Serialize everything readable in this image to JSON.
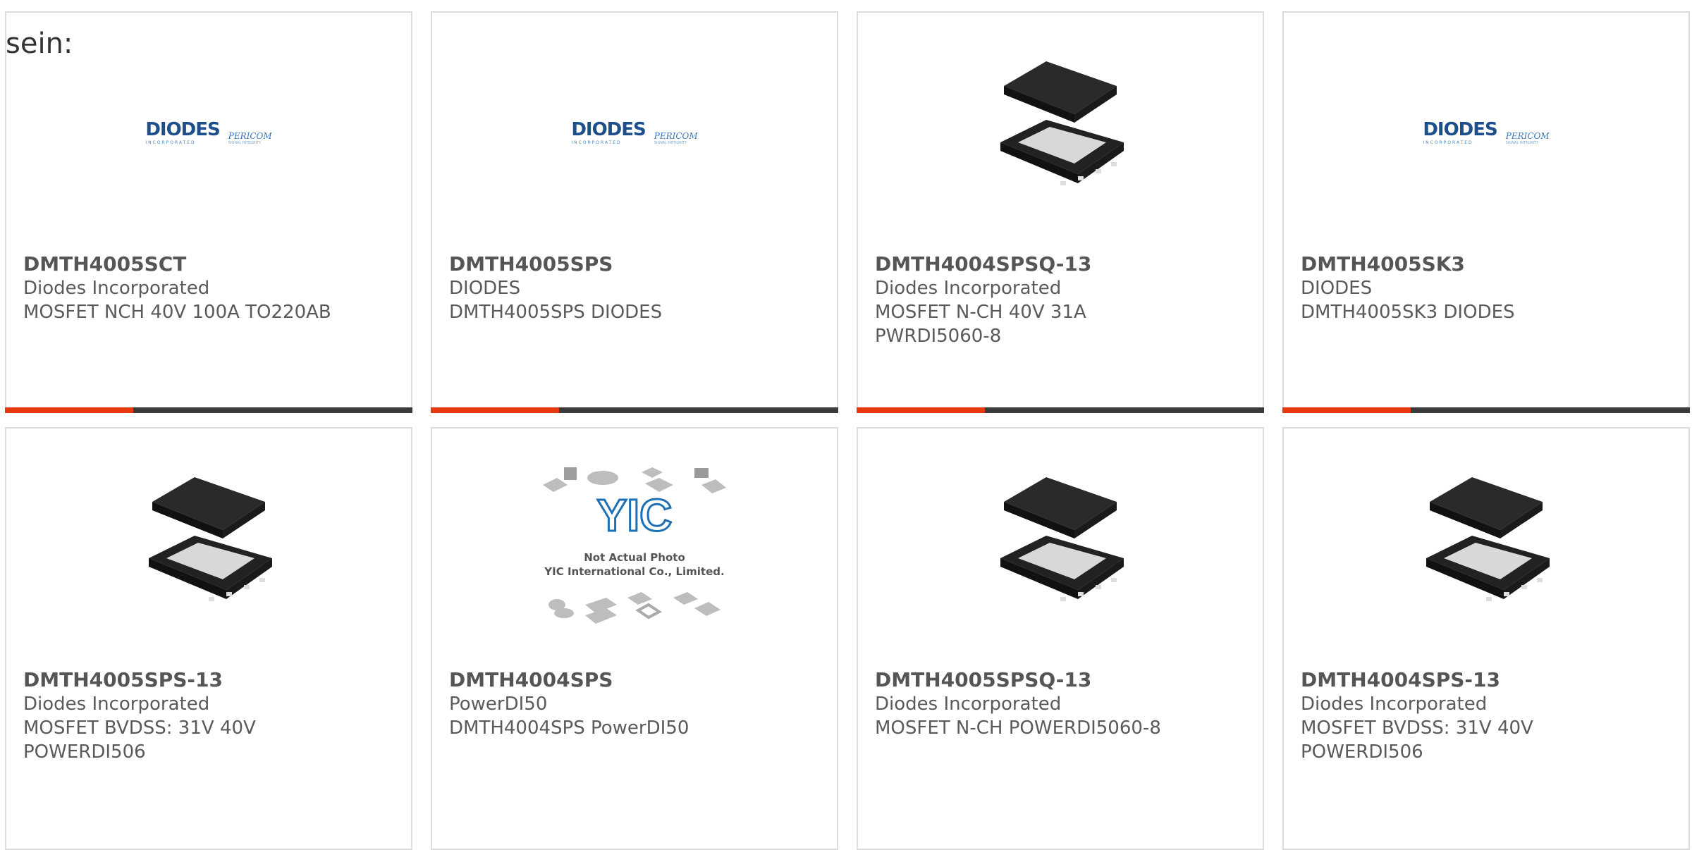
{
  "intro_text": "sein:",
  "products": [
    {
      "part": "DMTH4005SCT",
      "manufacturer": "Diodes Incorporated",
      "description": "MOSFET NCH 40V 100A TO220AB",
      "image": "diodes-pericom-logo"
    },
    {
      "part": "DMTH4005SPS",
      "manufacturer": "DIODES",
      "description": "DMTH4005SPS DIODES",
      "image": "diodes-pericom-logo"
    },
    {
      "part": "DMTH4004SPSQ-13",
      "manufacturer": "Diodes Incorporated",
      "description": "MOSFET N-CH 40V 31A PWRDI5060-8",
      "image": "powerdi-package"
    },
    {
      "part": "DMTH4005SK3",
      "manufacturer": "DIODES",
      "description": "DMTH4005SK3 DIODES",
      "image": "diodes-pericom-logo"
    },
    {
      "part": "DMTH4005SPS-13",
      "manufacturer": "Diodes Incorporated",
      "description": "MOSFET BVDSS: 31V 40V POWERDI506",
      "image": "powerdi-package"
    },
    {
      "part": "DMTH4004SPS",
      "manufacturer": "PowerDI50",
      "description": "DMTH4004SPS PowerDI50",
      "image": "yic-placeholder"
    },
    {
      "part": "DMTH4005SPSQ-13",
      "manufacturer": "Diodes Incorporated",
      "description": "MOSFET N-CH POWERDI5060-8",
      "image": "powerdi-package"
    },
    {
      "part": "DMTH4004SPS-13",
      "manufacturer": "Diodes Incorporated",
      "description": "MOSFET BVDSS: 31V 40V POWERDI506",
      "image": "powerdi-package"
    }
  ],
  "logo": {
    "diodes": "DIODES",
    "diodes_sub": "INCORPORATED",
    "pericom": "PERICOM",
    "pericom_sub": "SIGNAL INTEGRITY"
  },
  "yic": {
    "mark": "YIC",
    "line1": "Not Actual Photo",
    "line2": "YIC International Co., Limited."
  },
  "colors": {
    "accent": "#e53a10",
    "bar": "#3a3a3a",
    "border": "#dddddd",
    "diodes_blue": "#1c4f8c"
  }
}
